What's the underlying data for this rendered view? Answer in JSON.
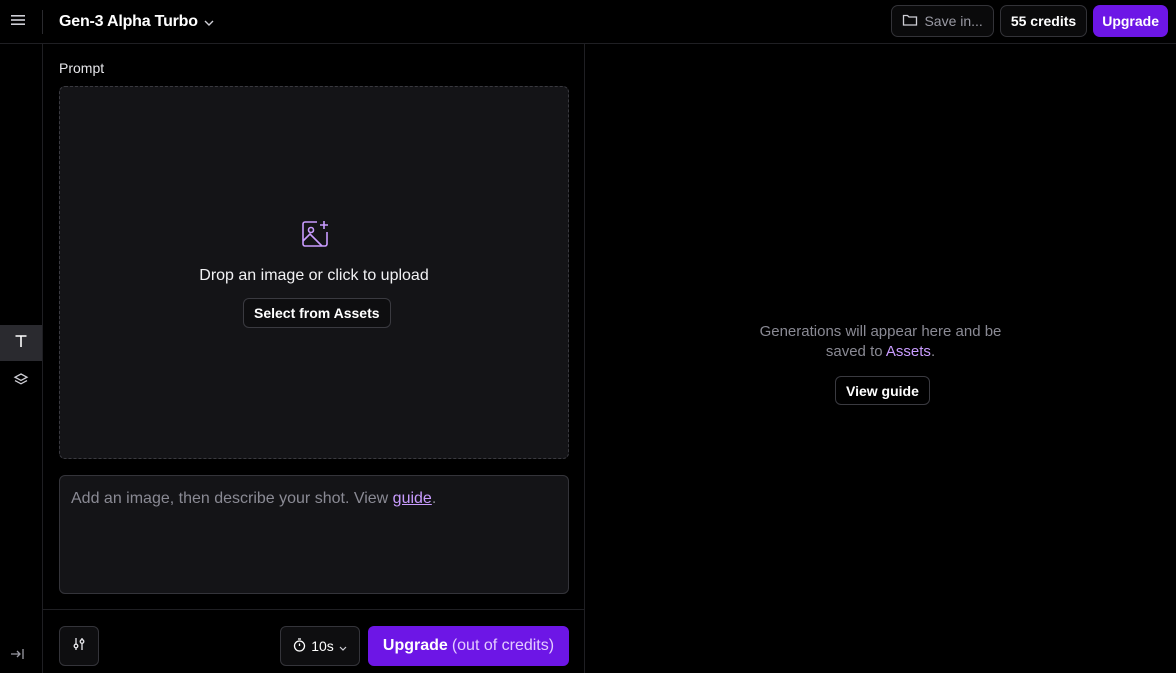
{
  "header": {
    "model_name": "Gen-3 Alpha Turbo",
    "save_label": "Save in...",
    "credits_label": "55 credits",
    "upgrade_label": "Upgrade"
  },
  "rail": {
    "items": [
      {
        "name": "text-tool",
        "icon": "type-icon"
      },
      {
        "name": "layers-tool",
        "icon": "layers-icon"
      }
    ],
    "expand_icon": "expand-icon"
  },
  "prompt": {
    "label": "Prompt",
    "dropzone_text": "Drop an image or click to upload",
    "select_assets_label": "Select from Assets",
    "textarea_placeholder_prefix": "Add an image, then describe your shot. View ",
    "textarea_link": "guide",
    "textarea_placeholder_suffix": "."
  },
  "footer": {
    "duration": "10s",
    "upgrade_strong": "Upgrade",
    "upgrade_muted": "(out of credits)"
  },
  "output": {
    "empty_line1": "Generations will appear here and be",
    "empty_line2_prefix": "saved to ",
    "empty_assets_link": "Assets",
    "empty_line2_suffix": ".",
    "view_guide_label": "View guide"
  },
  "colors": {
    "accent": "#6d16e6",
    "link": "#c99cff",
    "background": "#000000",
    "panel": "#141417"
  }
}
